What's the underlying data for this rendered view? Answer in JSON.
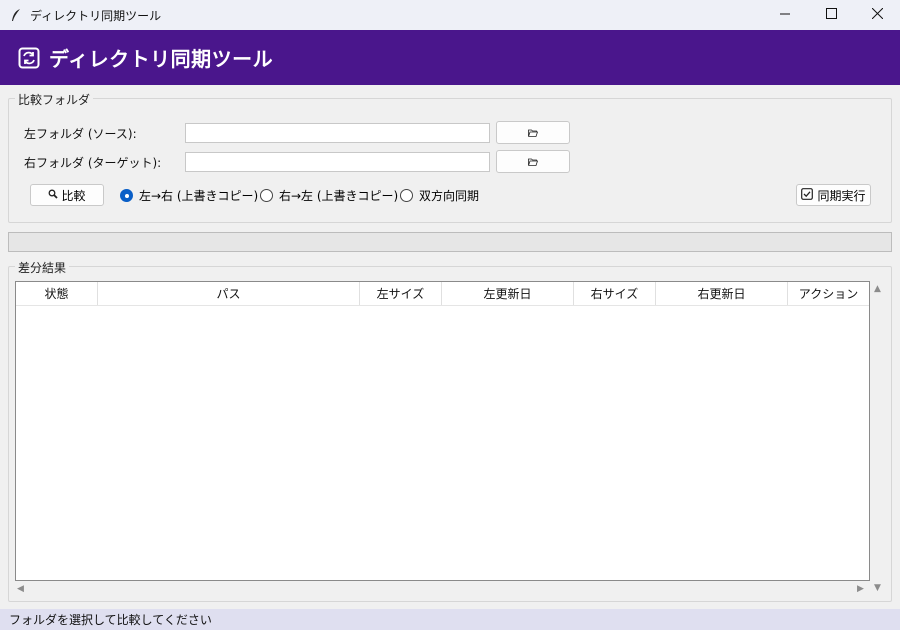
{
  "window": {
    "title": "ディレクトリ同期ツール",
    "minimize_icon": "minimize-icon",
    "maximize_icon": "maximize-icon",
    "close_icon": "close-icon"
  },
  "header": {
    "title": "ディレクトリ同期ツール",
    "icon": "sync-icon",
    "background": "#4a168c"
  },
  "compare_folder": {
    "group_label": "比較フォルダ",
    "left_label": "左フォルダ (ソース):",
    "left_value": "",
    "right_label": "右フォルダ (ターゲット):",
    "right_value": "",
    "browse_icon": "folder-open-icon",
    "compare_button": "比較",
    "compare_icon": "magnifier-icon",
    "modes": [
      {
        "label": "左→右 (上書きコピー)",
        "selected": true
      },
      {
        "label": "右→左 (上書きコピー)",
        "selected": false
      },
      {
        "label": "双方向同期",
        "selected": false
      }
    ],
    "sync_button": "同期実行",
    "sync_icon": "checkbox-icon"
  },
  "progress": {
    "value": 0
  },
  "diff_results": {
    "group_label": "差分結果",
    "columns": [
      "状態",
      "パス",
      "左サイズ",
      "左更新日",
      "右サイズ",
      "右更新日",
      "アクション"
    ],
    "rows": []
  },
  "status_bar": {
    "text": "フォルダを選択して比較してください"
  },
  "colors": {
    "accent": "#4a168c",
    "radio_selected": "#0a5fc7",
    "status_bar": "#dfdff0"
  }
}
